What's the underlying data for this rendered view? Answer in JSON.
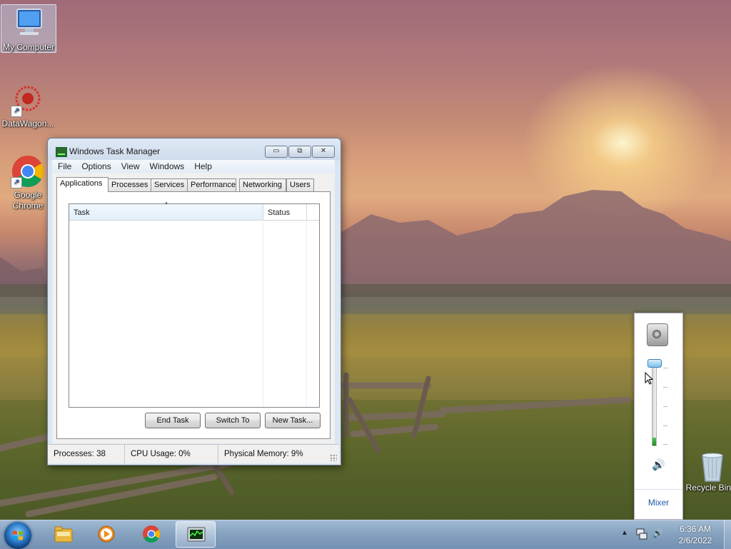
{
  "desktop": {
    "icons": [
      {
        "label": "My Computer"
      },
      {
        "label": "DataWagon..."
      },
      {
        "label": "Google Chrome"
      },
      {
        "label": "Recycle Bin"
      }
    ]
  },
  "window": {
    "title": "Windows Task Manager",
    "menu": [
      "File",
      "Options",
      "View",
      "Windows",
      "Help"
    ],
    "tabs": [
      "Applications",
      "Processes",
      "Services",
      "Performance",
      "Networking",
      "Users"
    ],
    "active_tab": "Applications",
    "columns": [
      "Task",
      "Status"
    ],
    "buttons": {
      "end_task": "End Task",
      "switch_to": "Switch To",
      "new_task": "New Task..."
    },
    "status": {
      "processes": "Processes: 38",
      "cpu": "CPU Usage: 0%",
      "memory": "Physical Memory: 9%"
    },
    "caption_buttons": {
      "minimize": "▭",
      "restore": "⧉",
      "close": "✕"
    }
  },
  "volume": {
    "level_fraction": 0.1,
    "mixer_label": "Mixer"
  },
  "taskbar": {
    "pinned": [
      "Windows Explorer",
      "Windows Media Player",
      "Google Chrome",
      "Windows Task Manager"
    ],
    "active": "Windows Task Manager",
    "clock": {
      "time": "6:36 AM",
      "date": "2/6/2022"
    }
  }
}
